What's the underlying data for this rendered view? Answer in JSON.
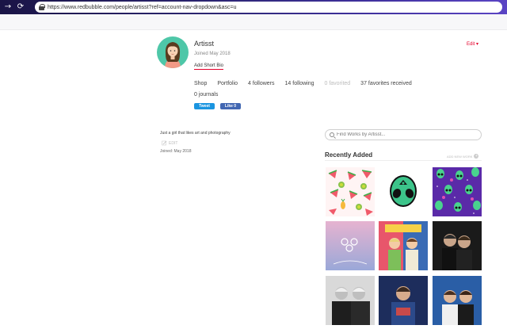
{
  "browser": {
    "url": "https://www.redbubble.com/people/artisst?ref=account-nav-dropdown&asc=u",
    "back_glyph": "←",
    "forward_glyph": "→",
    "reload_glyph": "⟳"
  },
  "profile": {
    "name": "Artisst",
    "joined": "Joined May 2018",
    "add_bio": "Add Short Bio",
    "edit": "Edit ▾"
  },
  "stats": {
    "shop": "Shop",
    "portfolio": "Portfolio",
    "followers": "4 followers",
    "following": "14 following",
    "favorited": "0 favorited",
    "favorites_received": "37 favorites received",
    "journals": "0 journals"
  },
  "social": {
    "tweet": "Tweet",
    "like": "Like 0"
  },
  "bio": {
    "text": "Just a girl that likes art and photography",
    "edit": "EDIT",
    "joined": "Joined: May 2018"
  },
  "works": {
    "search_placeholder": "Find Works by Artisst...",
    "recently_added": "Recently Added",
    "add_new_work": "ADD NEW WORK",
    "tiles": [
      {
        "name": "watermelon-pattern-tile",
        "bg": "#fbeeee"
      },
      {
        "name": "alien-sticker-tile",
        "bg": "#ffffff"
      },
      {
        "name": "alien-purple-pattern-tile",
        "bg": "#5b2aa5"
      },
      {
        "name": "wings-pastel-tile",
        "bg": "#c9b8d8"
      },
      {
        "name": "two-boys-comic-tile",
        "bg": "#3d6fb8"
      },
      {
        "name": "two-boys-dark-tile",
        "bg": "#1c1c1c"
      },
      {
        "name": "two-boys-bw-tile",
        "bg": "#2a2a2a"
      },
      {
        "name": "boy-blue-tile",
        "bg": "#1b2a5a"
      },
      {
        "name": "two-boys-blue-tile",
        "bg": "#2e5fa4"
      }
    ]
  },
  "colors": {
    "accent": "#e4002b",
    "avatar_bg": "#4ec7a8",
    "tweet": "#1b95e0",
    "facebook": "#4267b2"
  }
}
